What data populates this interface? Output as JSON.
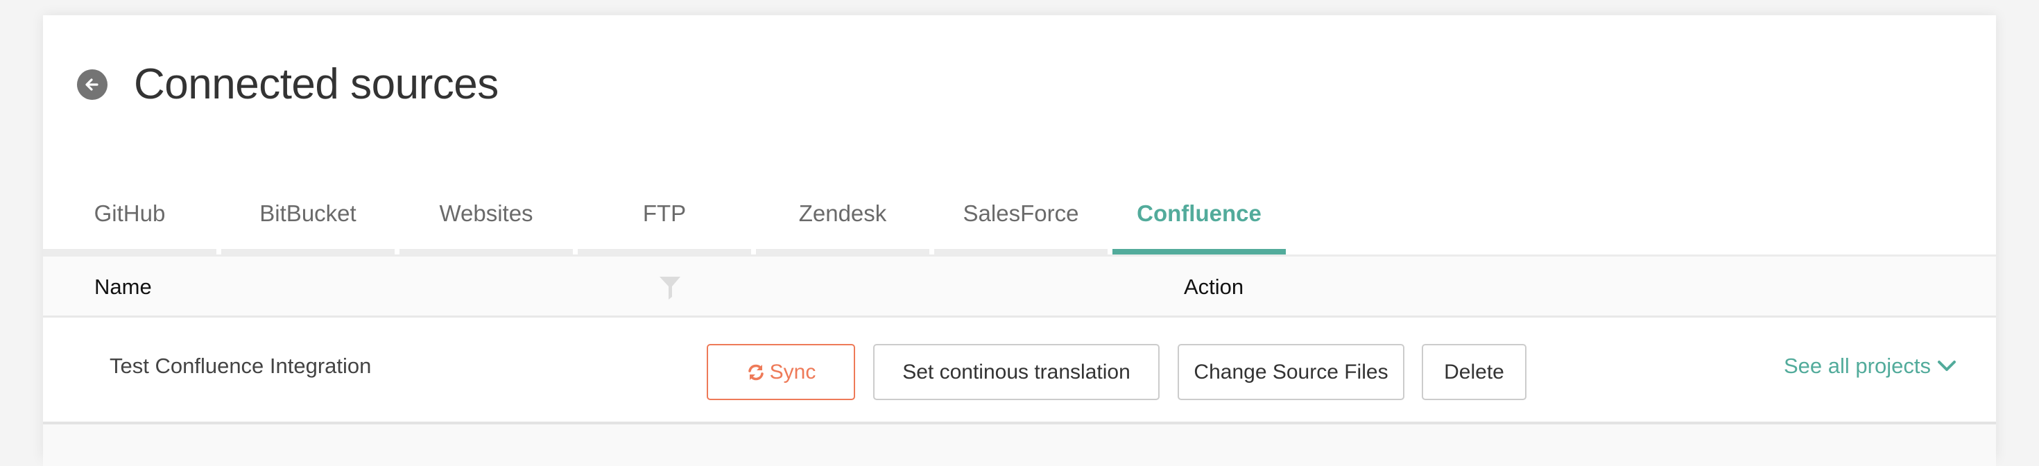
{
  "header": {
    "title": "Connected sources",
    "back_icon": "arrow-left-circle-icon"
  },
  "tabs": [
    {
      "label": "GitHub",
      "active": false
    },
    {
      "label": "BitBucket",
      "active": false
    },
    {
      "label": "Websites",
      "active": false
    },
    {
      "label": "FTP",
      "active": false
    },
    {
      "label": "Zendesk",
      "active": false
    },
    {
      "label": "SalesForce",
      "active": false
    },
    {
      "label": "Confluence",
      "active": true
    }
  ],
  "table": {
    "columns": {
      "name": "Name",
      "action": "Action"
    },
    "filter_icon": "filter-funnel-icon",
    "rows": [
      {
        "name": "Test Confluence Integration",
        "actions": {
          "sync": "Sync",
          "continuous": "Set continous translation",
          "change_source": "Change Source Files",
          "delete": "Delete"
        },
        "see_all": "See all projects"
      }
    ]
  },
  "colors": {
    "accent": "#52ab9b",
    "sync": "#ee7a58",
    "background": "#f4f4f4"
  }
}
